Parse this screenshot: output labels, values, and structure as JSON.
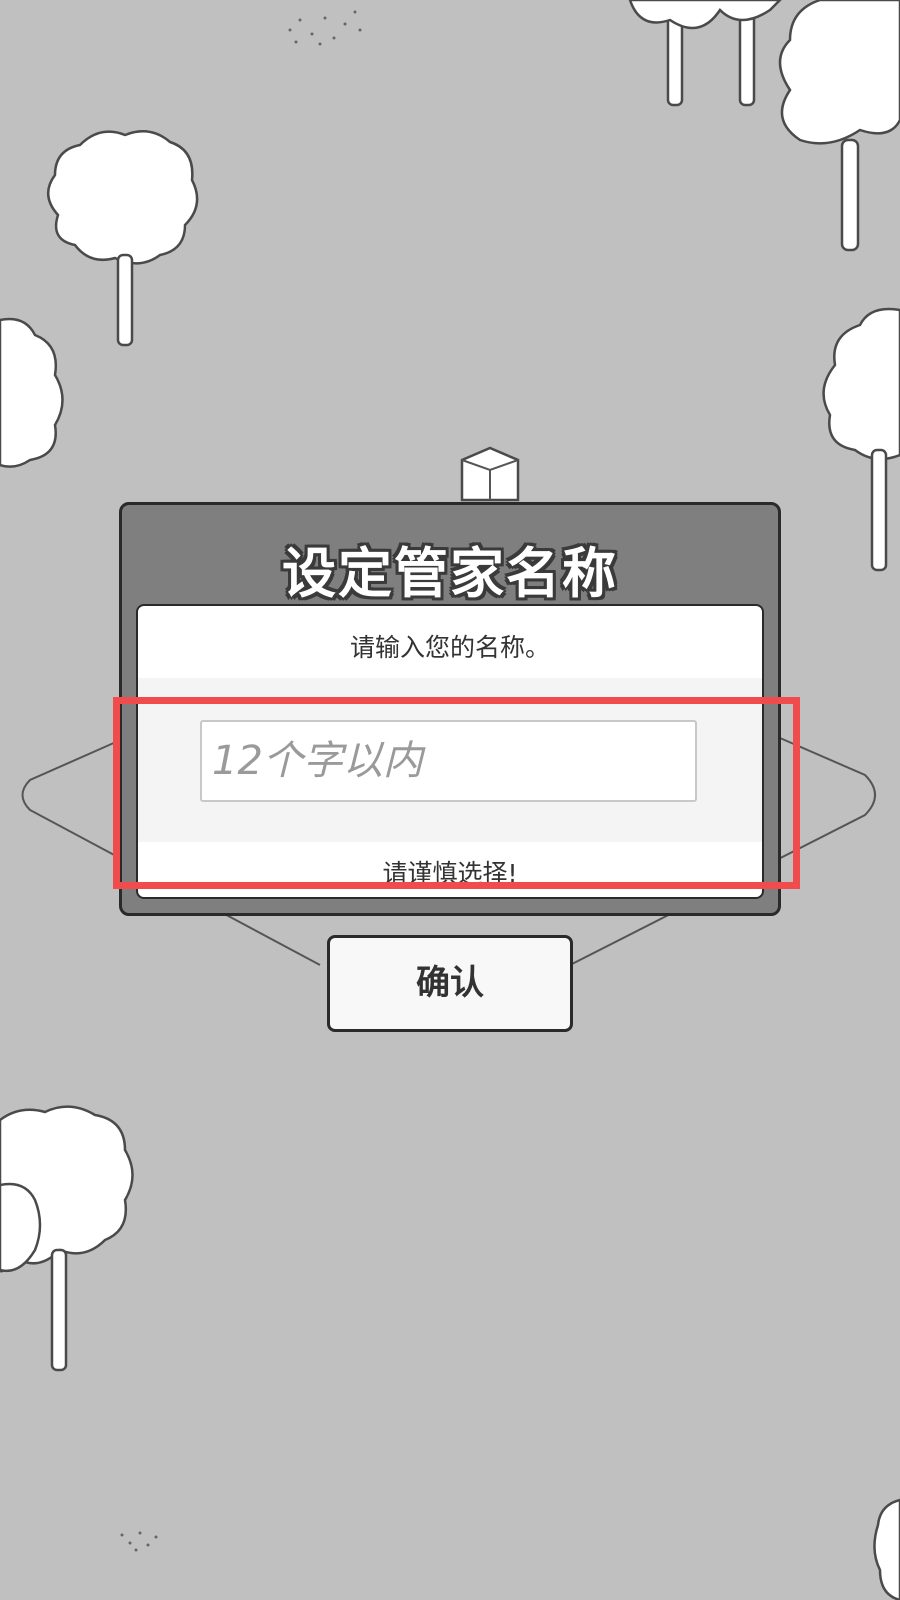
{
  "dialog": {
    "title": "设定管家名称",
    "prompt": "请输入您的名称。",
    "input": {
      "placeholder": "12个字以内",
      "value": ""
    },
    "warning": "请谨慎选择!",
    "confirm_label": "确认"
  },
  "colors": {
    "background": "#c0c0c0",
    "dialog_frame": "#7f7f7f",
    "highlight": "#f24b4b"
  }
}
